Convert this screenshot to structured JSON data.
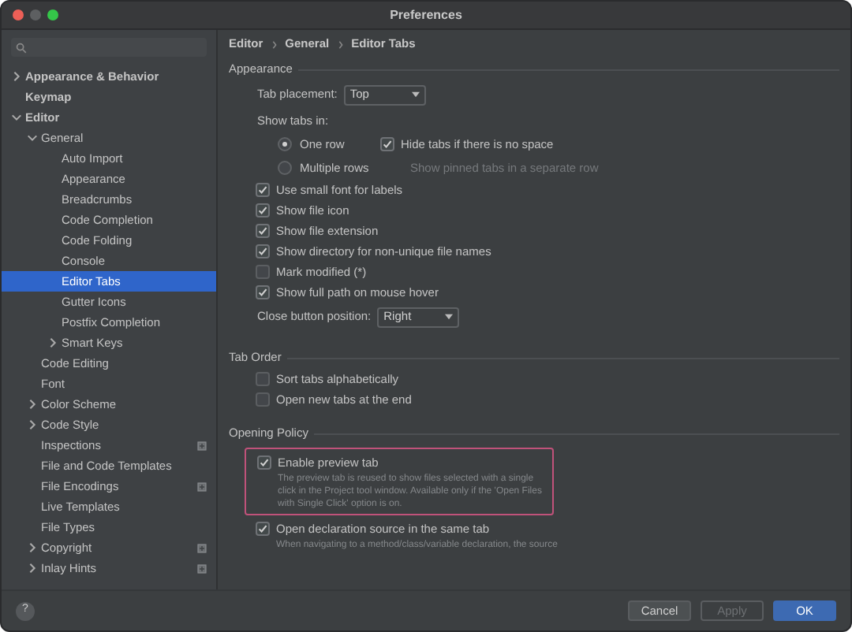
{
  "window": {
    "title": "Preferences"
  },
  "sidebar": {
    "items": [
      {
        "label": "Appearance & Behavior",
        "bold": true,
        "expanded": false,
        "expandable": true,
        "selected": false
      },
      {
        "label": "Keymap",
        "bold": true,
        "expandable": false,
        "selected": false
      },
      {
        "label": "Editor",
        "bold": true,
        "expandable": true,
        "expanded": true,
        "selected": false,
        "children": [
          {
            "label": "General",
            "expandable": true,
            "expanded": true,
            "selected": false,
            "children": [
              {
                "label": "Auto Import",
                "selected": false
              },
              {
                "label": "Appearance",
                "selected": false
              },
              {
                "label": "Breadcrumbs",
                "selected": false
              },
              {
                "label": "Code Completion",
                "selected": false
              },
              {
                "label": "Code Folding",
                "selected": false
              },
              {
                "label": "Console",
                "selected": false
              },
              {
                "label": "Editor Tabs",
                "selected": true
              },
              {
                "label": "Gutter Icons",
                "selected": false
              },
              {
                "label": "Postfix Completion",
                "selected": false
              },
              {
                "label": "Smart Keys",
                "expandable": true,
                "expanded": false,
                "selected": false
              }
            ]
          },
          {
            "label": "Code Editing",
            "selected": false
          },
          {
            "label": "Font",
            "selected": false
          },
          {
            "label": "Color Scheme",
            "expandable": true,
            "expanded": false,
            "selected": false
          },
          {
            "label": "Code Style",
            "expandable": true,
            "expanded": false,
            "selected": false
          },
          {
            "label": "Inspections",
            "selected": false,
            "scope_icon": true
          },
          {
            "label": "File and Code Templates",
            "selected": false
          },
          {
            "label": "File Encodings",
            "selected": false,
            "scope_icon": true
          },
          {
            "label": "Live Templates",
            "selected": false
          },
          {
            "label": "File Types",
            "selected": false
          },
          {
            "label": "Copyright",
            "expandable": true,
            "expanded": false,
            "selected": false,
            "scope_icon": true
          },
          {
            "label": "Inlay Hints",
            "expandable": true,
            "expanded": false,
            "selected": false,
            "scope_icon": true
          }
        ]
      }
    ]
  },
  "breadcrumb": [
    "Editor",
    "General",
    "Editor Tabs"
  ],
  "sections": [
    {
      "title": "Appearance",
      "rows": [
        {
          "kind": "dropdown",
          "label": "Tab placement:",
          "value": "Top"
        },
        {
          "kind": "label",
          "text": "Show tabs in:"
        },
        {
          "kind": "radio",
          "label": "One row",
          "selected": true,
          "extra": {
            "kind": "checkbox",
            "label": "Hide tabs if there is no space",
            "checked": true
          }
        },
        {
          "kind": "radio",
          "label": "Multiple rows",
          "selected": false,
          "extra": {
            "kind": "hint",
            "text": "Show pinned tabs in a separate row"
          }
        },
        {
          "kind": "checkbox",
          "label": "Use small font for labels",
          "checked": true
        },
        {
          "kind": "checkbox",
          "label": "Show file icon",
          "checked": true
        },
        {
          "kind": "checkbox",
          "label": "Show file extension",
          "checked": true
        },
        {
          "kind": "checkbox",
          "label": "Show directory for non-unique file names",
          "checked": true
        },
        {
          "kind": "checkbox",
          "label": "Mark modified (*)",
          "checked": false
        },
        {
          "kind": "checkbox",
          "label": "Show full path on mouse hover",
          "checked": true
        },
        {
          "kind": "dropdown",
          "label": "Close button position:",
          "value": "Right"
        }
      ]
    },
    {
      "title": "Tab Order",
      "rows": [
        {
          "kind": "checkbox",
          "label": "Sort tabs alphabetically",
          "checked": false
        },
        {
          "kind": "checkbox",
          "label": "Open new tabs at the end",
          "checked": false
        }
      ]
    },
    {
      "title": "Opening Policy",
      "rows": [
        {
          "kind": "checkbox",
          "label": "Enable preview tab",
          "checked": true,
          "highlighted": true,
          "description": "The preview tab is reused to show files selected with a single click in the Project tool window. Available only if the 'Open Files with Single Click' option is on."
        },
        {
          "kind": "checkbox",
          "label": "Open declaration source in the same tab",
          "checked": true,
          "highlighted": false,
          "description": "When navigating to a method/class/variable declaration, the source"
        }
      ]
    }
  ],
  "footer": {
    "help": "?",
    "buttons": [
      {
        "label": "Cancel",
        "disabled": false,
        "default": false
      },
      {
        "label": "Apply",
        "disabled": true,
        "default": false
      },
      {
        "label": "OK",
        "disabled": false,
        "default": true
      }
    ]
  }
}
